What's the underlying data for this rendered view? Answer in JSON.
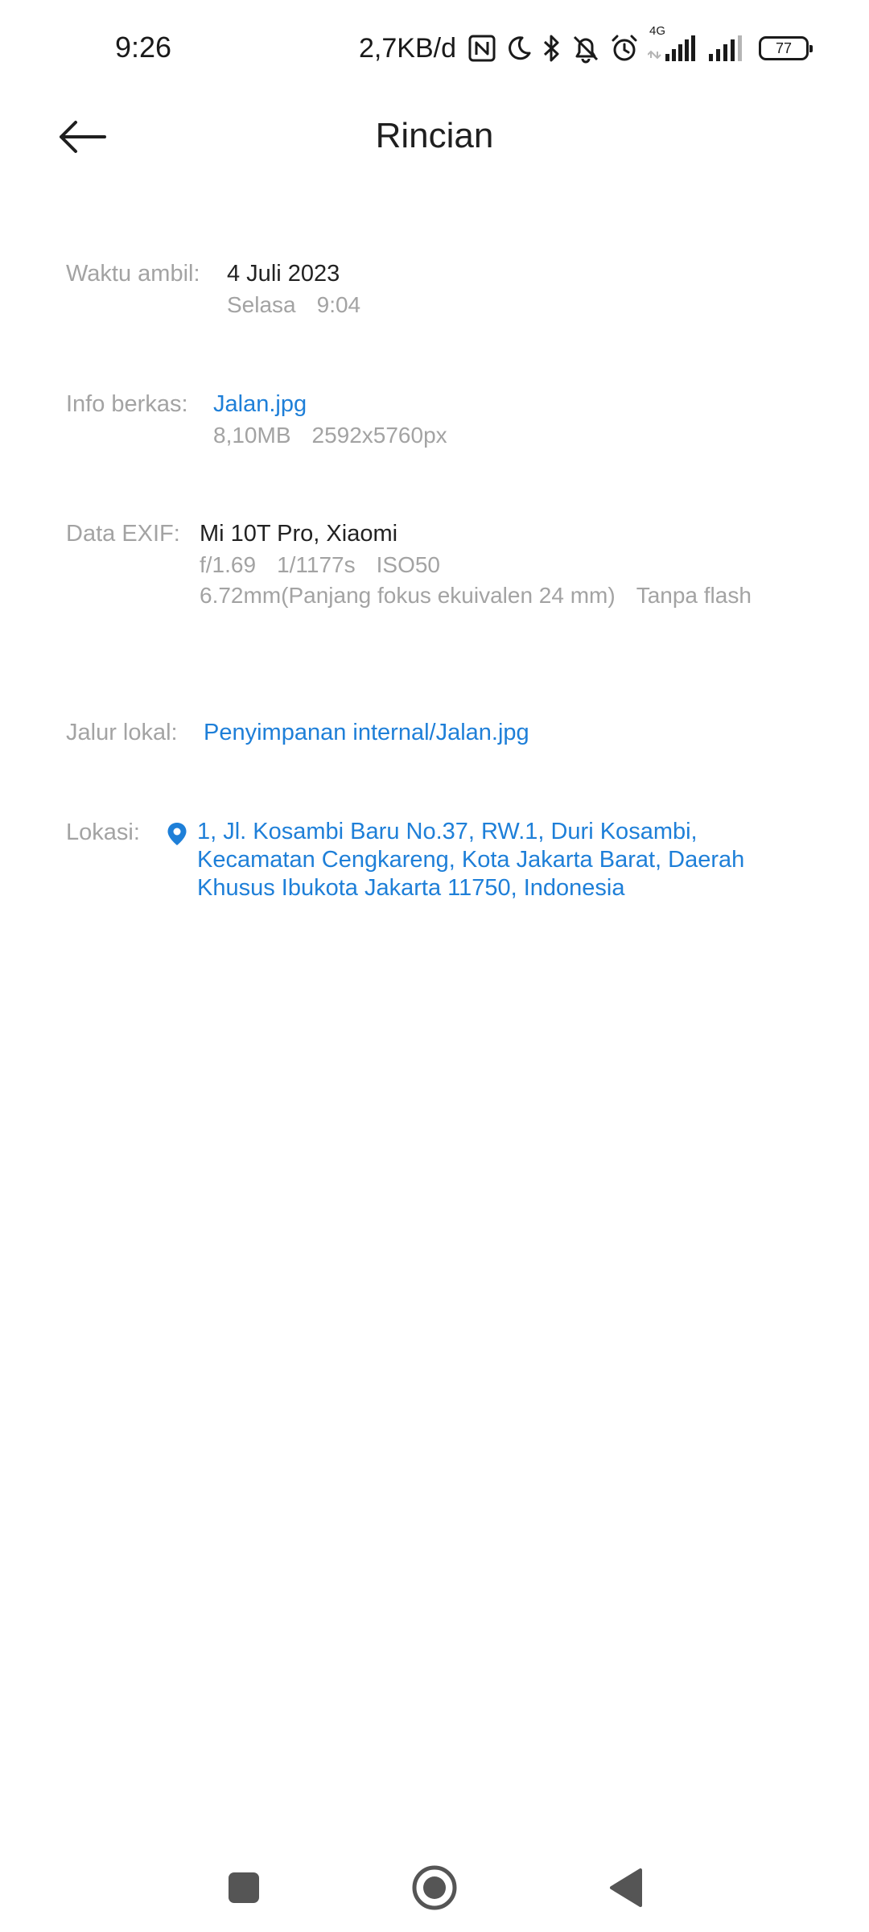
{
  "status_bar": {
    "time": "9:26",
    "net_speed": "2,7KB/d",
    "network_type": "4G",
    "battery": "77",
    "icons": [
      "nfc-icon",
      "moon-icon",
      "bluetooth-icon",
      "bell-off-icon",
      "alarm-icon",
      "signal-icon",
      "signal-icon",
      "battery-icon"
    ]
  },
  "header": {
    "title": "Rincian",
    "back_icon": "arrow-left-icon"
  },
  "details": {
    "time_taken": {
      "label": "Waktu ambil:",
      "date": "4 Juli 2023",
      "day": "Selasa",
      "time": "9:04"
    },
    "file_info": {
      "label": "Info berkas:",
      "name": "Jalan.jpg",
      "size": "8,10MB",
      "resolution": "2592x5760px"
    },
    "exif": {
      "label": "Data EXIF:",
      "device": "Mi 10T Pro, Xiaomi",
      "aperture": "f/1.69",
      "shutter": "1/1177s",
      "iso": "ISO50",
      "focal": "6.72mm(Panjang fokus ekuivalen 24 mm)",
      "flash": "Tanpa flash"
    },
    "local_path": {
      "label": "Jalur lokal:",
      "path": "Penyimpanan internal/Jalan.jpg"
    },
    "location": {
      "label": "Lokasi:",
      "icon": "location-pin-icon",
      "address": "1, Jl. Kosambi Baru No.37, RW.1, Duri Kosambi, Kecamatan Cengkareng, Kota Jakarta Barat, Daerah Khusus Ibukota Jakarta 11750, Indonesia"
    }
  },
  "nav_bar": {
    "icons": [
      "recents-square-icon",
      "home-circle-icon",
      "back-triangle-icon"
    ]
  },
  "colors": {
    "link": "#1e7fd8",
    "label": "#a3a3a3",
    "text": "#222222",
    "background": "#ffffff"
  }
}
